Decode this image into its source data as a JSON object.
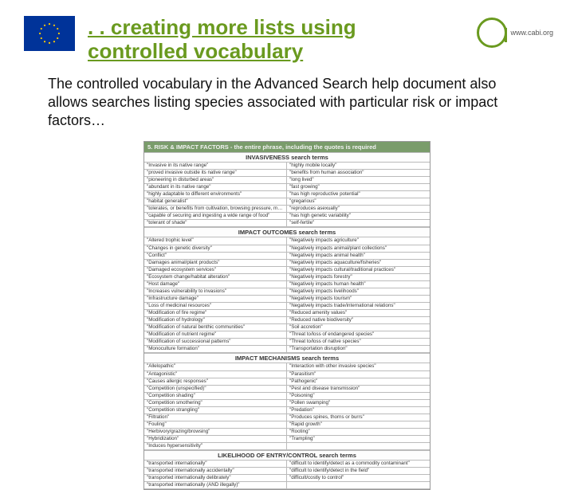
{
  "header": {
    "title": ". . creating more lists using controlled vocabulary",
    "cabi_url": "www.cabi.org"
  },
  "intro": "The controlled vocabulary in the Advanced Search help document also allows searches listing species associated with particular risk or impact factors…",
  "section_header": "5. RISK & IMPACT FACTORS - the entire phrase, including the quotes is required",
  "subsections": [
    {
      "title": "INVASIVENESS search terms",
      "rows": [
        [
          "\"Invasive in its native range\"",
          "\"highly mobile locally\""
        ],
        [
          "\"proved invasive outside its native range\"",
          "\"benefits from human association\""
        ],
        [
          "\"pioneering in disturbed areas\"",
          "\"long lived\""
        ],
        [
          "\"abundant in its native range\"",
          "\"fast growing\""
        ],
        [
          "\"highly adaptable to different environments\"",
          "\"has high reproductive potential\""
        ],
        [
          "\"habitat generalist\"",
          "\"gregarious\""
        ],
        [
          "\"tolerates, or benefits from cultivation, browsing pressure, mutilation, fire etc\"",
          "\"reproduces asexually\""
        ],
        [
          "\"capable of securing and ingesting a wide range of food\"",
          "\"has high genetic variability\""
        ],
        [
          "\"tolerant of shade\"",
          "\"self-fertile\""
        ]
      ]
    },
    {
      "title": "IMPACT OUTCOMES search terms",
      "rows": [
        [
          "\"Altered trophic level\"",
          "\"Negatively impacts agriculture\""
        ],
        [
          "\"Changes in genetic diversity\"",
          "\"Negatively impacts animal/plant collections\""
        ],
        [
          "\"Conflict\"",
          "\"Negatively impacts animal health\""
        ],
        [
          "\"Damages animal/plant products\"",
          "\"Negatively impacts aquaculture/fisheries\""
        ],
        [
          "\"Damaged ecosystem services\"",
          "\"Negatively impacts cultural/traditional practices\""
        ],
        [
          "\"Ecosystem change/habitat alteration\"",
          "\"Negatively impacts forestry\""
        ],
        [
          "\"Host damage\"",
          "\"Negatively impacts human health\""
        ],
        [
          "\"Increases vulnerability to invasions\"",
          "\"Negatively impacts livelihoods\""
        ],
        [
          "\"Infrastructure damage\"",
          "\"Negatively impacts tourism\""
        ],
        [
          "\"Loss of medicinal resources\"",
          "\"Negatively impacts trade/international relations\""
        ],
        [
          "\"Modification of fire regime\"",
          "\"Reduced amenity values\""
        ],
        [
          "\"Modification of hydrology\"",
          "\"Reduced native biodiversity\""
        ],
        [
          "\"Modification of natural benthic communities\"",
          "\"Soil accretion\""
        ],
        [
          "\"Modification of nutrient regime\"",
          "\"Threat to/loss of endangered species\""
        ],
        [
          "\"Modification of successional patterns\"",
          "\"Threat to/loss of native species\""
        ],
        [
          "\"Monoculture formation\"",
          "\"Transportation disruption\""
        ]
      ]
    },
    {
      "title": "IMPACT MECHANISMS search terms",
      "rows": [
        [
          "\"Allelopathic\"",
          "\"Interaction with other invasive species\""
        ],
        [
          "\"Antagonistic\"",
          "\"Parasitism\""
        ],
        [
          "\"Causes allergic responses\"",
          "\"Pathogenic\""
        ],
        [
          "\"Competition (unspecified)\"",
          "\"Pest and disease transmission\""
        ],
        [
          "\"Competition shading\"",
          "\"Poisoning\""
        ],
        [
          "\"Competition smothering\"",
          "\"Pollen swamping\""
        ],
        [
          "\"Competition strangling\"",
          "\"Predation\""
        ],
        [
          "\"Filtration\"",
          "\"Produces spines, thorns or burrs\""
        ],
        [
          "\"Fouling\"",
          "\"Rapid growth\""
        ],
        [
          "\"Herbivory/grazing/browsing\"",
          "\"Rooting\""
        ],
        [
          "\"Hybridization\"",
          "\"Trampling\""
        ],
        [
          "\"Induces hypersensitivity\"",
          ""
        ]
      ]
    },
    {
      "title": "LIKELIHOOD OF ENTRY/CONTROL search terms",
      "rows": [
        [
          "\"transported internationally\"",
          "\"difficult to identify/detect as a commodity contaminant\""
        ],
        [
          "\"transported internationally accidentally\"",
          "\"difficult to identify/detect in the field\""
        ],
        [
          "\"transported internationally delibrately\"",
          "\"difficult/costly to control\""
        ],
        [
          "\"transported internationally (AND illegally)\"",
          ""
        ]
      ]
    }
  ]
}
